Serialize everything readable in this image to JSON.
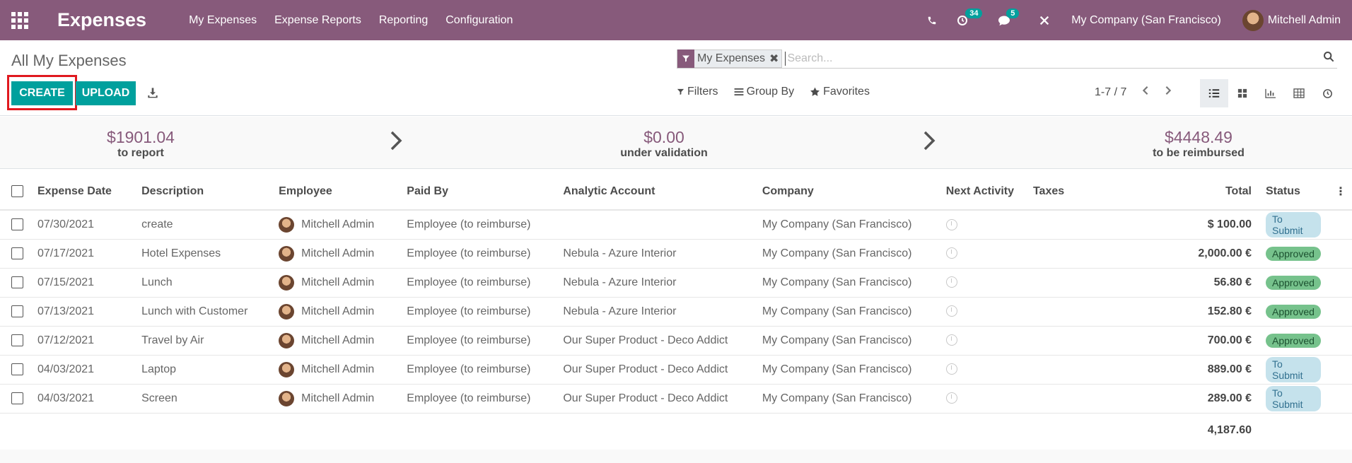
{
  "navbar": {
    "brand": "Expenses",
    "menu": [
      "My Expenses",
      "Expense Reports",
      "Reporting",
      "Configuration"
    ],
    "activities_count": "34",
    "messages_count": "5",
    "company": "My Company (San Francisco)",
    "user": "Mitchell Admin",
    "color": "#875a7b"
  },
  "control_panel": {
    "breadcrumb": "All My Expenses",
    "facet": "My Expenses",
    "search_placeholder": "Search...",
    "create_label": "CREATE",
    "upload_label": "UPLOAD",
    "filters_label": "Filters",
    "groupby_label": "Group By",
    "favorites_label": "Favorites",
    "pager": "1-7 / 7"
  },
  "dashboard": {
    "to_report_amount": "$1901.04",
    "to_report_label": "to report",
    "validation_amount": "$0.00",
    "validation_label": "under validation",
    "reimbursed_amount": "$4448.49",
    "reimbursed_label": "to be reimbursed"
  },
  "table": {
    "headers": [
      "Expense Date",
      "Description",
      "Employee",
      "Paid By",
      "Analytic Account",
      "Company",
      "Next Activity",
      "Taxes",
      "Total",
      "Status"
    ],
    "rows": [
      {
        "date": "07/30/2021",
        "desc": "create",
        "employee": "Mitchell Admin",
        "paid_by": "Employee (to reimburse)",
        "analytic": "",
        "company": "My Company (San Francisco)",
        "total": "$ 100.00",
        "status": "To Submit"
      },
      {
        "date": "07/17/2021",
        "desc": "Hotel Expenses",
        "employee": "Mitchell Admin",
        "paid_by": "Employee (to reimburse)",
        "analytic": "Nebula - Azure Interior",
        "company": "My Company (San Francisco)",
        "total": "2,000.00 €",
        "status": "Approved"
      },
      {
        "date": "07/15/2021",
        "desc": "Lunch",
        "employee": "Mitchell Admin",
        "paid_by": "Employee (to reimburse)",
        "analytic": "Nebula - Azure Interior",
        "company": "My Company (San Francisco)",
        "total": "56.80 €",
        "status": "Approved"
      },
      {
        "date": "07/13/2021",
        "desc": "Lunch with Customer",
        "employee": "Mitchell Admin",
        "paid_by": "Employee (to reimburse)",
        "analytic": "Nebula - Azure Interior",
        "company": "My Company (San Francisco)",
        "total": "152.80 €",
        "status": "Approved"
      },
      {
        "date": "07/12/2021",
        "desc": "Travel by Air",
        "employee": "Mitchell Admin",
        "paid_by": "Employee (to reimburse)",
        "analytic": "Our Super Product - Deco Addict",
        "company": "My Company (San Francisco)",
        "total": "700.00 €",
        "status": "Approved"
      },
      {
        "date": "04/03/2021",
        "desc": "Laptop",
        "employee": "Mitchell Admin",
        "paid_by": "Employee (to reimburse)",
        "analytic": "Our Super Product - Deco Addict",
        "company": "My Company (San Francisco)",
        "total": "889.00 €",
        "status": "To Submit"
      },
      {
        "date": "04/03/2021",
        "desc": "Screen",
        "employee": "Mitchell Admin",
        "paid_by": "Employee (to reimburse)",
        "analytic": "Our Super Product - Deco Addict",
        "company": "My Company (San Francisco)",
        "total": "289.00 €",
        "status": "To Submit"
      }
    ],
    "grand_total": "4,187.60"
  }
}
